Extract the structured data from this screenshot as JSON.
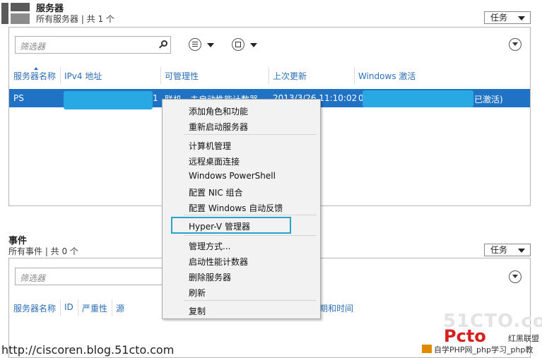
{
  "servers_section": {
    "title": "服务器",
    "subtitle": "所有服务器 | 共 1 个",
    "tasks_label": "任务",
    "filter_placeholder": "筛选器",
    "columns": [
      "服务器名称",
      "IPv4 地址",
      "可管理性",
      "上次更新",
      "Windows 激活"
    ],
    "selected_row": {
      "name": "PS",
      "ipv4_tail": "1",
      "manageability": "联机 - 未启动性能计数器",
      "last_update": "2013/3/26 11:10:02",
      "activation_prefix": "0",
      "activation_suffix": "已激活)"
    }
  },
  "events_section": {
    "title": "事件",
    "subtitle": "所有事件 | 共 0 个",
    "tasks_label": "任务",
    "filter_placeholder": "筛选器",
    "columns": [
      "服务器名称",
      "ID",
      "严重性",
      "源",
      "期和时间"
    ]
  },
  "context_menu": {
    "group1": [
      "添加角色和功能",
      "重新启动服务器"
    ],
    "group2": [
      "计算机管理",
      "远程桌面连接",
      "Windows PowerShell",
      "配置 NIC 组合",
      "配置 Windows 自动反馈"
    ],
    "highlighted": "Hyper-V 管理器",
    "group3": [
      "管理方式...",
      "启动性能计数器",
      "删除服务器",
      "刷新"
    ],
    "group4": [
      "复制"
    ]
  },
  "watermarks": {
    "url": "http://ciscoren.blog.51cto.com",
    "site": "51CTO.com",
    "logo_text": "Pcto",
    "logo_sub": "红黑联盟",
    "footer": "自学PHP网_php学习_php教"
  },
  "colors": {
    "accent_blue": "#1f72c4",
    "header_blue": "#2b6fb7",
    "redaction": "#29a9e3",
    "highlight_border": "#2aa3c8"
  }
}
